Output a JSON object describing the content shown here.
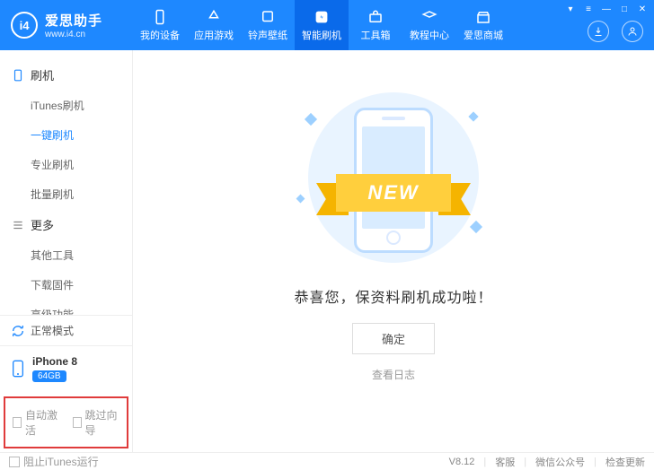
{
  "brand": {
    "name": "爱思助手",
    "site": "www.i4.cn",
    "logo_text": "i4"
  },
  "top_nav": [
    {
      "label": "我的设备",
      "icon": "device"
    },
    {
      "label": "应用游戏",
      "icon": "apps"
    },
    {
      "label": "铃声壁纸",
      "icon": "ringtone"
    },
    {
      "label": "智能刷机",
      "icon": "flash",
      "active": true
    },
    {
      "label": "工具箱",
      "icon": "toolbox"
    },
    {
      "label": "教程中心",
      "icon": "tutorial"
    },
    {
      "label": "爱思商城",
      "icon": "store"
    }
  ],
  "sidebar": {
    "groups": [
      {
        "title": "刷机",
        "icon": "flash-side",
        "items": [
          {
            "label": "iTunes刷机"
          },
          {
            "label": "一键刷机",
            "active": true
          },
          {
            "label": "专业刷机"
          },
          {
            "label": "批量刷机"
          }
        ]
      },
      {
        "title": "更多",
        "icon": "more",
        "items": [
          {
            "label": "其他工具"
          },
          {
            "label": "下载固件"
          },
          {
            "label": "高级功能"
          }
        ]
      }
    ],
    "status": {
      "label": "正常模式"
    },
    "device": {
      "name": "iPhone 8",
      "storage": "64GB"
    },
    "options": {
      "auto_activate": "自动激活",
      "skip_guide": "跳过向导"
    }
  },
  "content": {
    "ribbon_text": "NEW",
    "success_text": "恭喜您，保资料刷机成功啦！",
    "ok_button": "确定",
    "log_link": "查看日志"
  },
  "footer": {
    "block_itunes": "阻止iTunes运行",
    "version": "V8.12",
    "support": "客服",
    "wechat": "微信公众号",
    "update": "检查更新"
  }
}
